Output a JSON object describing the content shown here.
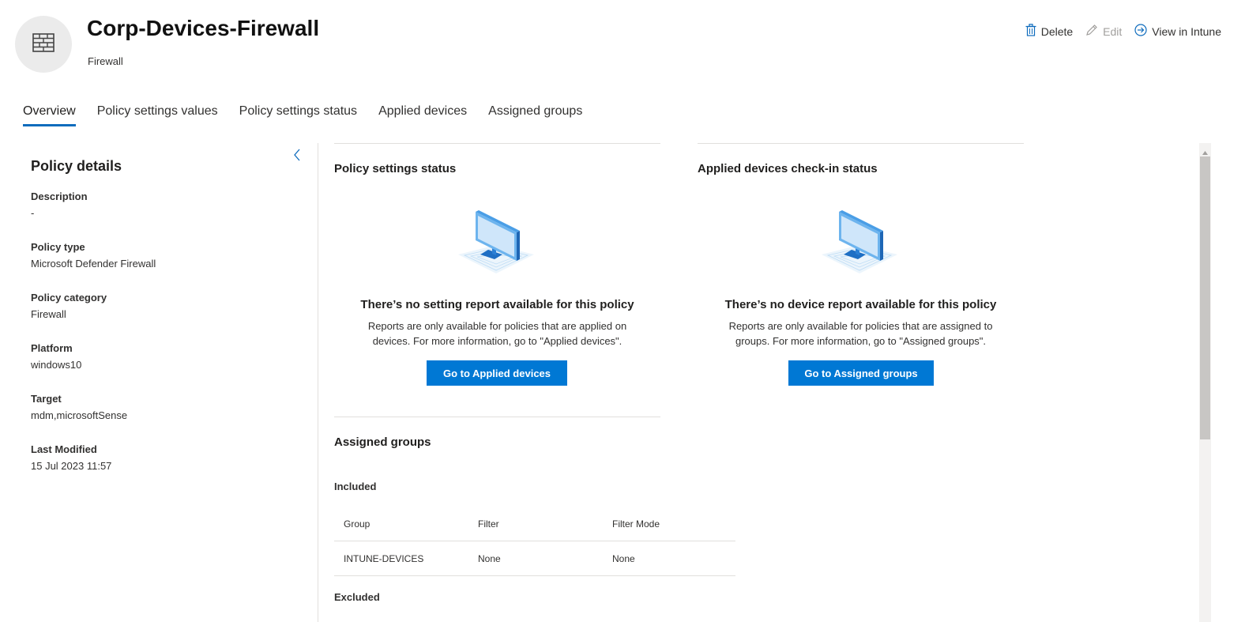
{
  "header": {
    "title": "Corp-Devices-Firewall",
    "subtitle": "Firewall",
    "icon": "firewall-icon",
    "actions": {
      "delete": "Delete",
      "edit": "Edit",
      "view": "View in Intune"
    }
  },
  "tabs": [
    {
      "label": "Overview",
      "active": true
    },
    {
      "label": "Policy settings values",
      "active": false
    },
    {
      "label": "Policy settings status",
      "active": false
    },
    {
      "label": "Applied devices",
      "active": false
    },
    {
      "label": "Assigned groups",
      "active": false
    }
  ],
  "details": {
    "title": "Policy details",
    "fields": [
      {
        "label": "Description",
        "value": "-"
      },
      {
        "label": "Policy type",
        "value": "Microsoft Defender Firewall"
      },
      {
        "label": "Policy category",
        "value": "Firewall"
      },
      {
        "label": "Platform",
        "value": "windows10"
      },
      {
        "label": "Target",
        "value": "mdm,microsoftSense"
      },
      {
        "label": "Last Modified",
        "value": "15 Jul 2023 11:57"
      }
    ]
  },
  "settings_status": {
    "title": "Policy settings status",
    "empty_title": "There’s no setting report available for this policy",
    "empty_line1": "Reports are only available for policies that are applied on",
    "empty_line2": "devices. For more information, go to \"Applied devices\".",
    "button": "Go to Applied devices"
  },
  "devices_status": {
    "title": "Applied devices check-in status",
    "empty_title": "There’s no device report available for this policy",
    "empty_line1": "Reports are only available for policies that are assigned to",
    "empty_line2": "groups. For more information, go to \"Assigned groups\".",
    "button": "Go to Assigned groups"
  },
  "assigned_groups": {
    "title": "Assigned groups",
    "included_label": "Included",
    "columns": [
      "Group",
      "Filter",
      "Filter Mode"
    ],
    "rows": [
      [
        "INTUNE-DEVICES",
        "None",
        "None"
      ]
    ],
    "excluded_label": "Excluded"
  },
  "colors": {
    "accent": "#0078d4",
    "tab_underline": "#0f6cbd"
  }
}
